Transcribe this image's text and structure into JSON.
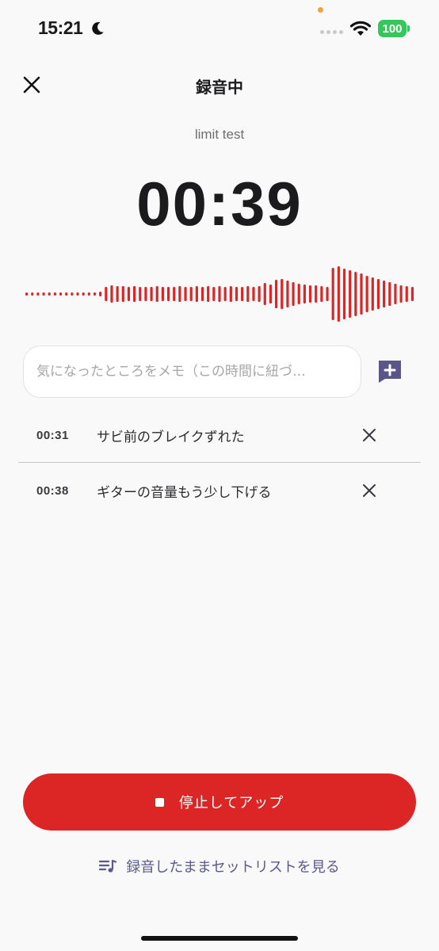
{
  "status_bar": {
    "time": "15:21",
    "battery": "100"
  },
  "header": {
    "title": "録音中"
  },
  "recording": {
    "name": "limit test",
    "elapsed": "00:39"
  },
  "memo_input": {
    "placeholder": "気になったところをメモ（この時間に紐づ…",
    "value": ""
  },
  "memos": [
    {
      "time": "00:31",
      "text": "サビ前のブレイクずれた"
    },
    {
      "time": "00:38",
      "text": "ギターの音量もう少し下げる"
    }
  ],
  "actions": {
    "stop_label": "停止してアップ",
    "setlist_label": "録音したままセットリストを見る"
  },
  "colors": {
    "accent_red": "#dc2626",
    "accent_purple": "#5b5a8c",
    "battery_green": "#34c759"
  },
  "icons": [
    "moon-icon",
    "wifi-icon",
    "close-icon",
    "add-comment-icon",
    "delete-icon",
    "stop-icon",
    "playlist-music-icon"
  ]
}
